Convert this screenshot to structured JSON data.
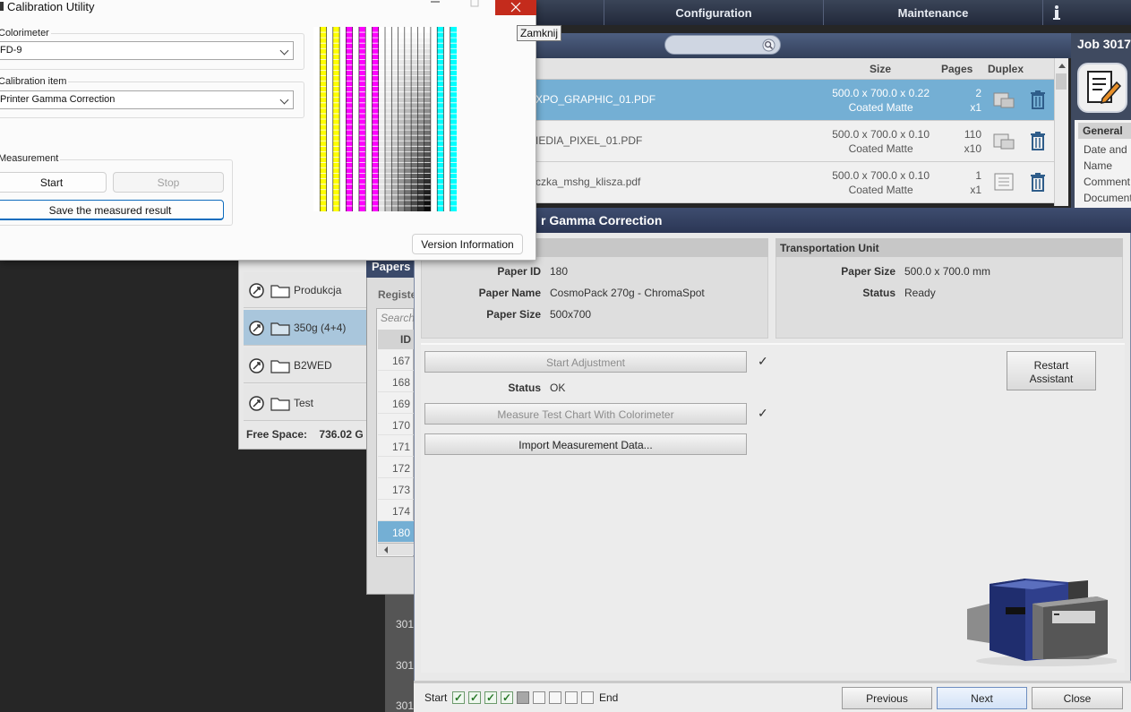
{
  "app": {
    "tabs": [
      {
        "label": "Configuration"
      },
      {
        "label": "Maintenance"
      }
    ],
    "job_panel": {
      "job_id": "Job 3017",
      "general_header": "General",
      "general_items": [
        "Date and",
        "Name",
        "Comment",
        "Document"
      ]
    },
    "job_list": {
      "headers": {
        "size": "Size",
        "pages": "Pages",
        "duplex": "Duplex"
      },
      "rows": [
        {
          "name": "XPO_GRAPHIC_01.PDF",
          "size": "500.0 x 700.0 x 0.22",
          "media": "Coated Matte",
          "pages": "2",
          "copies": "x1",
          "selected": true
        },
        {
          "name": "IEDIA_PIXEL_01.PDF",
          "size": "500.0 x 700.0 x 0.10",
          "media": "Coated Matte",
          "pages": "110",
          "copies": "x10",
          "selected": false
        },
        {
          "name": "czka_mshg_klisza.pdf",
          "size": "500.0 x 700.0 x 0.10",
          "media": "Coated Matte",
          "pages": "1",
          "copies": "x1",
          "selected": false
        }
      ]
    },
    "hot_folders": {
      "items": [
        {
          "label": "Produkcja",
          "selected": false
        },
        {
          "label": "350g (4+4)",
          "selected": true
        },
        {
          "label": "B2WED",
          "selected": false
        },
        {
          "label": "Test",
          "selected": false
        }
      ],
      "free_space_label": "Free Space:",
      "free_space_value": "736.02 G"
    },
    "papers_window": {
      "title": "Papers",
      "register_label": "Registe",
      "search_placeholder": "Search",
      "id_header": "ID",
      "ids": [
        "167",
        "168",
        "169",
        "170",
        "171",
        "172",
        "173",
        "174",
        "180"
      ],
      "selected_id": "180",
      "dark_ids": [
        "301",
        "301",
        "301"
      ]
    }
  },
  "assistant": {
    "title": "r Gamma Correction",
    "paper_section": {
      "paper_id_label": "Paper ID",
      "paper_id": "180",
      "paper_name_label": "Paper Name",
      "paper_name": "CosmoPack 270g - ChromaSpot",
      "paper_size_label": "Paper Size",
      "paper_size": "500x700"
    },
    "transport_section": {
      "header": "Transportation Unit",
      "paper_size_label": "Paper Size",
      "paper_size": "500.0 x 700.0 mm",
      "status_label": "Status",
      "status": "Ready"
    },
    "actions": {
      "start_adjustment": "Start Adjustment",
      "status_label": "Status",
      "status": "OK",
      "measure": "Measure Test Chart With Colorimeter",
      "import": "Import Measurement Data...",
      "check": "✓",
      "restart_line1": "Restart",
      "restart_line2": "Assistant"
    },
    "wizard": {
      "start": "Start",
      "end": "End",
      "steps": [
        "done",
        "done",
        "done",
        "done",
        "current",
        "todo",
        "todo",
        "todo",
        "todo"
      ],
      "done_mark": "✓"
    },
    "nav": {
      "previous": "Previous",
      "next": "Next",
      "close": "Close"
    }
  },
  "calibration_utility": {
    "title": "Calibration Utility",
    "close_tooltip": "Zamknij",
    "colorimeter_label": "Colorimeter",
    "colorimeter_value": "FD-9",
    "calibration_item_label": "Calibration item",
    "calibration_item_value": "Printer Gamma Correction",
    "measurement_label": "Measurement",
    "start": "Start",
    "stop": "Stop",
    "save": "Save the measured result",
    "version": "Version Information",
    "chart_colors": {
      "yellow": "#ffff00",
      "magenta": "#ff00ff",
      "black": "#000000",
      "cyan": "#00ffff"
    }
  }
}
